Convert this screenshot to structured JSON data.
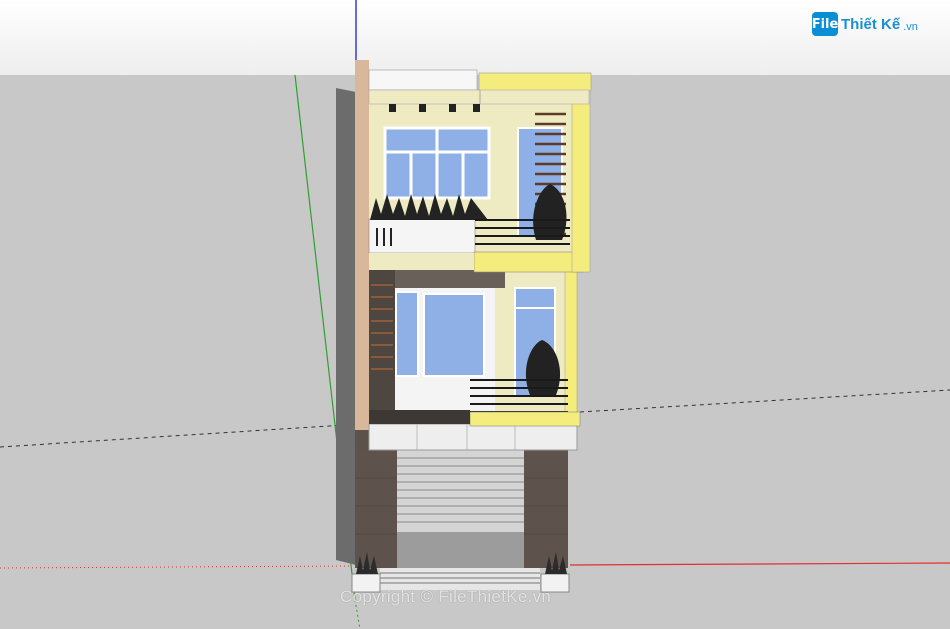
{
  "viewport": {
    "sky_color": "#ffffff",
    "ground_color": "#c8c8c8",
    "axis_colors": {
      "red": "#e03030",
      "green": "#2fa02f",
      "blue": "#3b3bd8"
    }
  },
  "model": {
    "wall_primary": "#efe9b4",
    "wall_accent": "#f4ec7c",
    "stone": "#5d534c",
    "glass": "#8fb0e6",
    "rail": "#1a1a1a",
    "shutter": "#d4d4d4"
  },
  "logo": {
    "mark": "File",
    "name": "Thiết Kế",
    "suffix": ".vn"
  },
  "watermark": {
    "text": "Copyright © FileThietKe.vn"
  }
}
